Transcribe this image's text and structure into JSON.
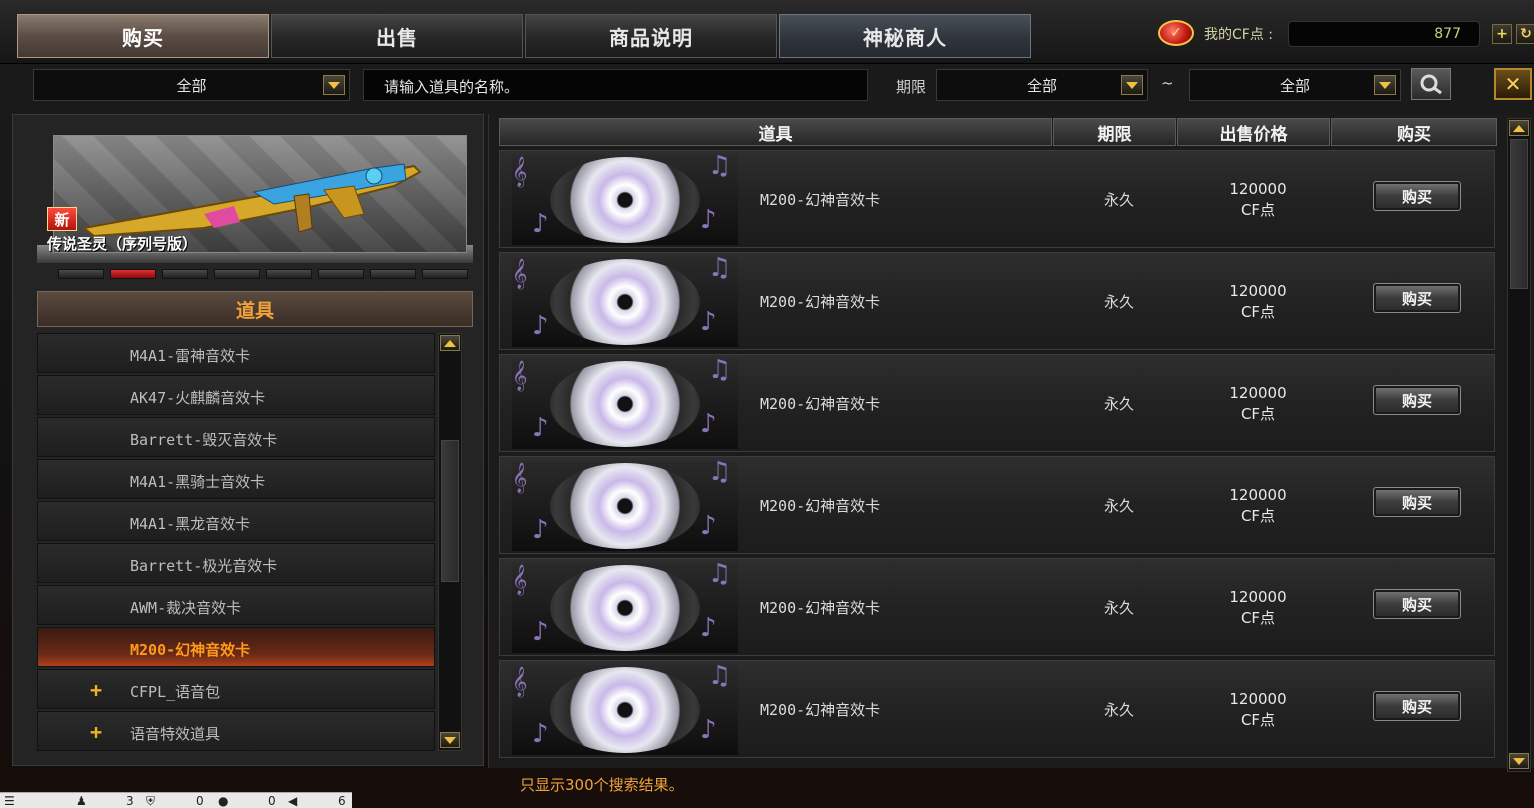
{
  "tabs": [
    {
      "label": "购买"
    },
    {
      "label": "出售"
    },
    {
      "label": "商品说明"
    },
    {
      "label": "神秘商人"
    }
  ],
  "cf_points": {
    "label": "我的CF点 :",
    "value": "877"
  },
  "filter": {
    "category": "全部",
    "search_placeholder": "请输入道具的名称。",
    "period_label": "期限",
    "period_from": "全部",
    "tilde": "~",
    "period_to": "全部"
  },
  "hero": {
    "badge": "新",
    "name": "传说圣灵（序列号版）"
  },
  "category_header": "道具",
  "list_items": [
    {
      "label": "M4A1-雷神音效卡"
    },
    {
      "label": "AK47-火麒麟音效卡"
    },
    {
      "label": "Barrett-毁灭音效卡"
    },
    {
      "label": "M4A1-黑骑士音效卡"
    },
    {
      "label": "M4A1-黑龙音效卡"
    },
    {
      "label": "Barrett-极光音效卡"
    },
    {
      "label": "AWM-裁决音效卡"
    },
    {
      "label": "M200-幻神音效卡"
    },
    {
      "label": "CFPL_语音包"
    },
    {
      "label": "语音特效道具"
    }
  ],
  "table": {
    "headers": [
      "道具",
      "期限",
      "出售价格",
      "购买"
    ],
    "rows": [
      {
        "name": "M200-幻神音效卡",
        "duration": "永久",
        "price": "120000",
        "unit": "CF点",
        "buy": "购买"
      },
      {
        "name": "M200-幻神音效卡",
        "duration": "永久",
        "price": "120000",
        "unit": "CF点",
        "buy": "购买"
      },
      {
        "name": "M200-幻神音效卡",
        "duration": "永久",
        "price": "120000",
        "unit": "CF点",
        "buy": "购买"
      },
      {
        "name": "M200-幻神音效卡",
        "duration": "永久",
        "price": "120000",
        "unit": "CF点",
        "buy": "购买"
      },
      {
        "name": "M200-幻神音效卡",
        "duration": "永久",
        "price": "120000",
        "unit": "CF点",
        "buy": "购买"
      },
      {
        "name": "M200-幻神音效卡",
        "duration": "永久",
        "price": "120000",
        "unit": "CF点",
        "buy": "购买"
      }
    ]
  },
  "result_note": "只显示300个搜索结果。",
  "status": {
    "a": "3",
    "b": "0",
    "c": "0",
    "d": "6"
  },
  "colors": {
    "accent": "#f0a23a",
    "active_list": "#ff9a1a",
    "cf_value": "#c8d27a"
  }
}
